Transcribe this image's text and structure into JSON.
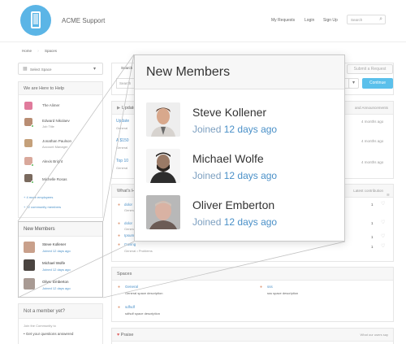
{
  "header": {
    "app_title": "ACME Support",
    "nav": [
      "My Requests",
      "Login",
      "Sign Up"
    ],
    "search_placeholder": "Search"
  },
  "breadcrumb": [
    "Home",
    "Spaces"
  ],
  "sidebar": {
    "select_space": "Select Space",
    "help_title": "We are Here to Help",
    "staff": [
      {
        "name": "The Alimer",
        "role": ""
      },
      {
        "name": "Edward Nikolaev",
        "role": "Job Title"
      },
      {
        "name": "Jonathan Paulson",
        "role": "Account Manager"
      },
      {
        "name": "Alexis Bright",
        "role": ""
      },
      {
        "name": "Michelle Rosas",
        "role": ""
      }
    ],
    "more_employees": "+ 4 more employees",
    "community_members": "+ 12 community members",
    "new_members_title": "New Members",
    "new_members": [
      {
        "name": "Steve Kollener",
        "joined": "Joined 12 days ago"
      },
      {
        "name": "Michael Wolfe",
        "joined": "Joined 12 days ago"
      },
      {
        "name": "Oliver Emberton",
        "joined": "Joined 12 days ago"
      }
    ],
    "not_member_title": "Not a member yet?",
    "join_text": "Join the Community to",
    "join_bullet": "Get your questions answered"
  },
  "main": {
    "search_label": "Search",
    "search_field_placeholder": "Search",
    "submit_request": "Submit a Request",
    "continue": "Continue",
    "updates_title": "Updates",
    "updates_right": "and Announcements",
    "updates": [
      {
        "title": "Update",
        "sub": "General",
        "time": "4 months ago"
      },
      {
        "title": "A $150",
        "sub": "General",
        "time": "4 months ago"
      },
      {
        "title": "Top 10",
        "sub": "General",
        "time": "4 months ago"
      }
    ],
    "whats_title": "What's H",
    "whats_right": "Latest contribution",
    "whats": [
      {
        "title": "dolor",
        "sub": "General",
        "count": "1"
      },
      {
        "title": "dolor",
        "sub": "General",
        "count": "1"
      },
      {
        "title": "Ipsum",
        "sub": "General",
        "count": "1"
      },
      {
        "title": "Gaving",
        "sub": "General • Problems",
        "count": "1"
      }
    ],
    "spaces_title": "Spaces",
    "spaces": [
      {
        "name": "General",
        "desc": "General space description"
      },
      {
        "name": "sss",
        "desc": "sss space description"
      },
      {
        "name": "sdfsdf",
        "desc": "sdfsdf space description"
      }
    ],
    "praise_title": "Praise",
    "praise_right": "What our users say"
  },
  "zoom": {
    "title": "New Members",
    "members": [
      {
        "name": "Steve Kollener",
        "joined_prefix": "Joined",
        "joined_rest": "12 days ago"
      },
      {
        "name": "Michael Wolfe",
        "joined_prefix": "Joined",
        "joined_rest": "12 days ago"
      },
      {
        "name": "Oliver Emberton",
        "joined_prefix": "Joined",
        "joined_rest": "12 days ago"
      }
    ]
  },
  "colors": {
    "accent": "#4a90c8",
    "logo_bg": "#5bb5e6",
    "button_blue": "#5bc0eb",
    "online": "#5cb85c"
  }
}
